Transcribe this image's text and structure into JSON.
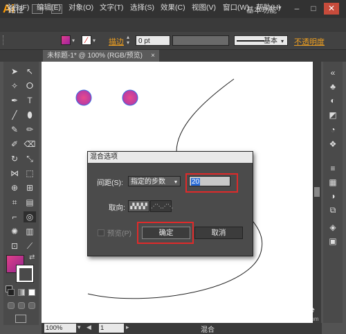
{
  "app": {
    "logo": "Ai",
    "workspace": "基本功能"
  },
  "window_controls": {
    "min": "–",
    "max": "□",
    "close": "✕"
  },
  "menu": [
    "文件(F)",
    "编辑(E)",
    "对象(O)",
    "文字(T)",
    "选择(S)",
    "效果(C)",
    "视图(V)",
    "窗口(W)",
    "帮助(H)"
  ],
  "control_bar": {
    "selection_type": "路径",
    "stroke_label": "描边",
    "stroke_weight": "0 pt",
    "brush_label": "基本",
    "opacity_label": "不透明度"
  },
  "document_tab": {
    "title": "未标题-1* @ 100% (RGB/预览)",
    "close": "×"
  },
  "status_bar": {
    "zoom": "100%",
    "page": "1",
    "mode": "混合"
  },
  "colors": {
    "fill_gradient_start": "#e0408a",
    "fill_gradient_end": "#a020a0",
    "highlight": "#e02a2a",
    "accent": "#ff9a00"
  },
  "dialog": {
    "title": "混合选项",
    "spacing_label": "间距(S):",
    "spacing_option": "指定的步数",
    "steps_value": "20",
    "orientation_label": "取向:",
    "preview_label": "预览(P)",
    "ok_label": "确定",
    "cancel_label": "取消"
  },
  "watermark": {
    "brand": "Baidu经验",
    "url": "jingyan.baidu.com"
  }
}
